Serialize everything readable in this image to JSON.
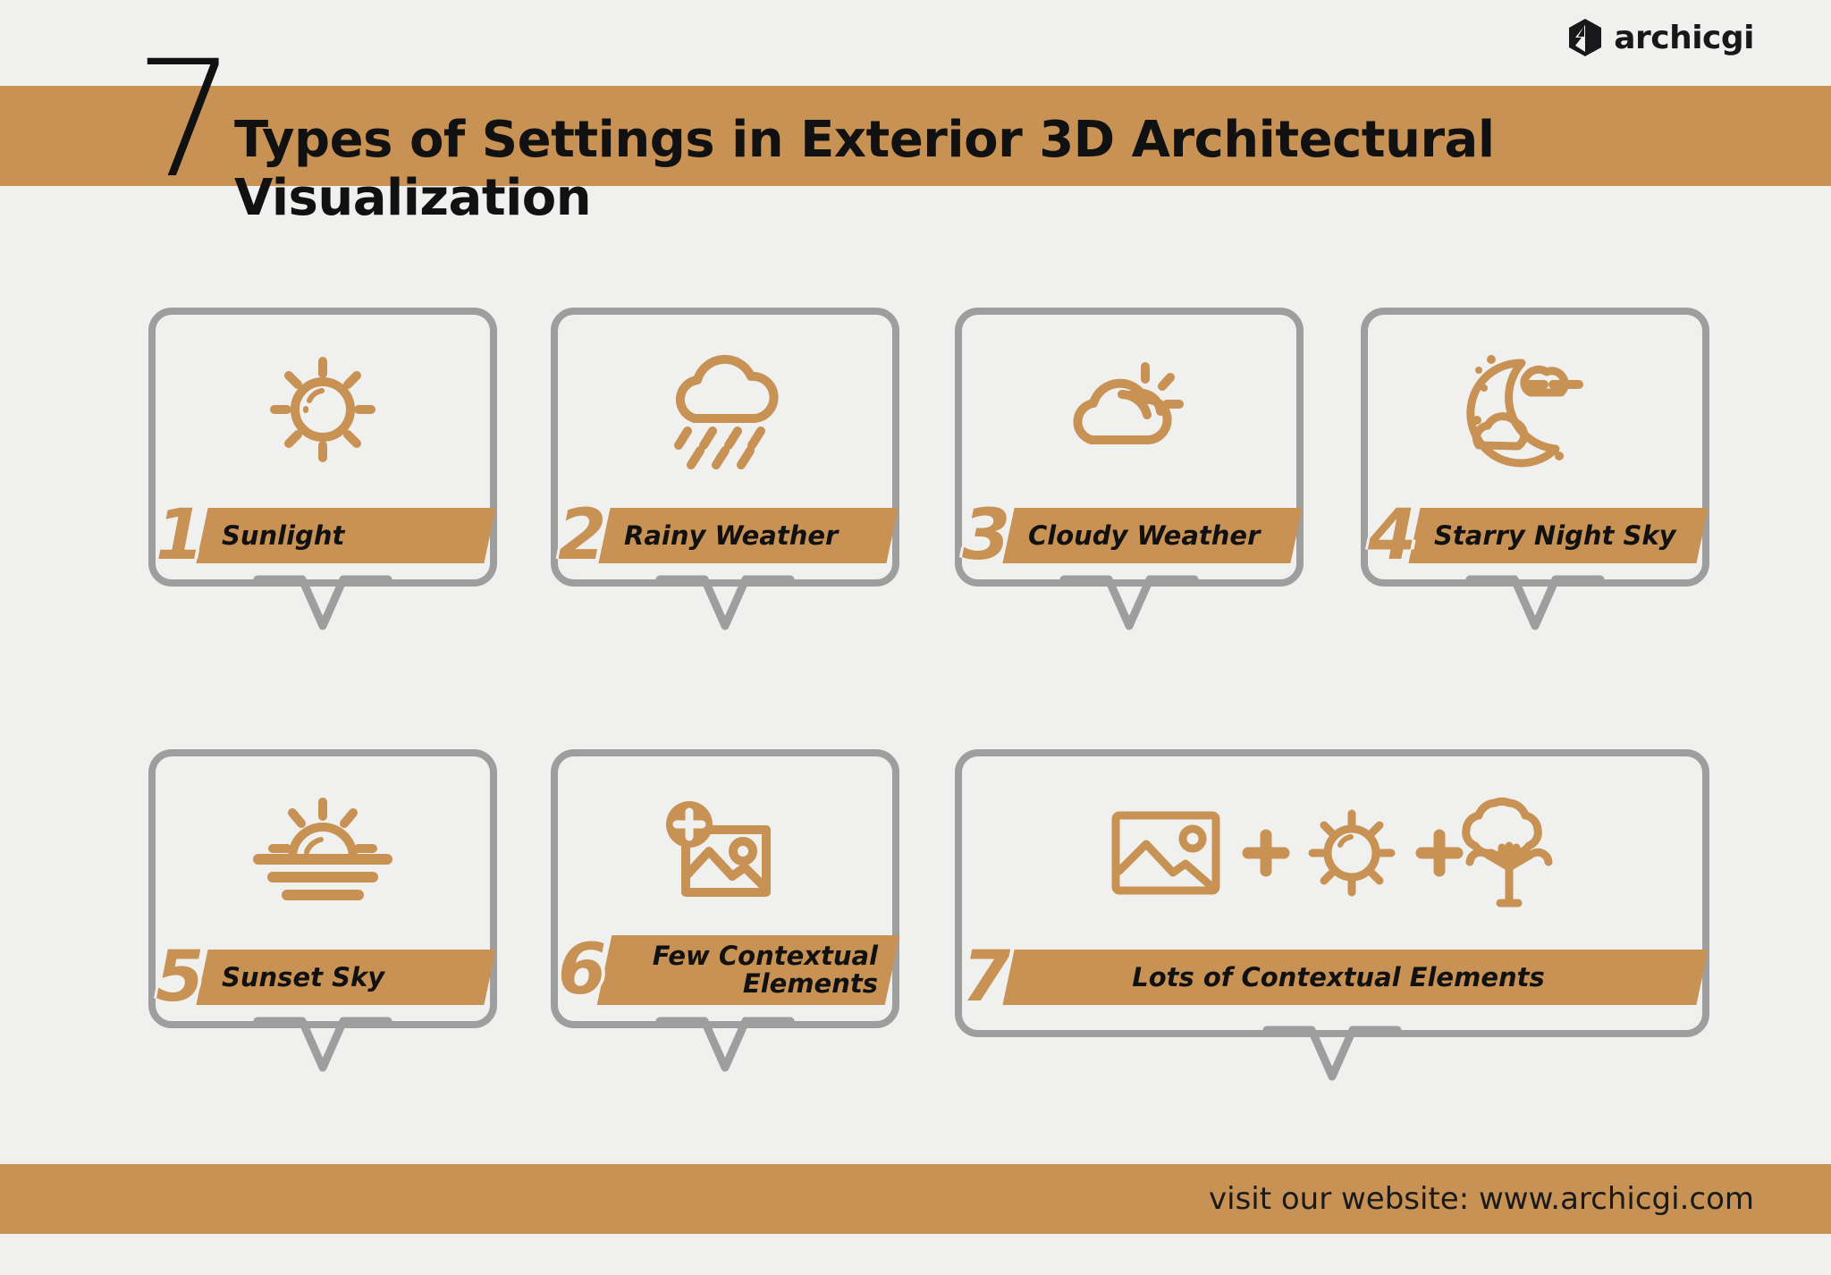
{
  "header": {
    "logo_text": "archicgi",
    "logo_icon": "archicgi-hexagon-logo"
  },
  "title": {
    "number": "7",
    "text": "Types of Settings in Exterior 3D Architectural Visualization"
  },
  "colors": {
    "accent": "#c89255",
    "border": "#9e9e9e",
    "background": "#f0f0ef",
    "text": "#111111"
  },
  "cards": [
    {
      "number": "1",
      "label": "Sunlight",
      "icon": "sun-icon"
    },
    {
      "number": "2",
      "label": "Rainy Weather",
      "icon": "rain-cloud-icon"
    },
    {
      "number": "3",
      "label": "Cloudy Weather",
      "icon": "cloud-sun-icon"
    },
    {
      "number": "4",
      "label": "Starry Night Sky",
      "icon": "moon-stars-icon"
    },
    {
      "number": "5",
      "label": "Sunset Sky",
      "icon": "sunset-icon"
    },
    {
      "number": "6",
      "label": "Few Contextual\nElements",
      "icon": "add-image-icon"
    },
    {
      "number": "7",
      "label": "Lots of Contextual Elements",
      "icon": "image-plus-sun-plus-tree-icon"
    }
  ],
  "footer": {
    "text": "visit our website: www.archicgi.com"
  }
}
